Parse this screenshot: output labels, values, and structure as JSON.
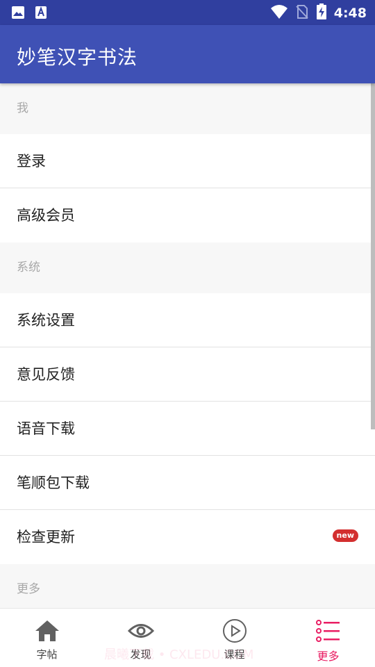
{
  "status_bar": {
    "time": "4:48",
    "left_icons": [
      "image-icon",
      "text-font-icon"
    ],
    "right_icons": [
      "wifi-icon",
      "no-sim-icon",
      "battery-charging-icon"
    ]
  },
  "app_bar": {
    "title": "妙笔汉字书法"
  },
  "sections": [
    {
      "header": "我",
      "items": [
        {
          "label": "登录"
        },
        {
          "label": "高级会员"
        }
      ]
    },
    {
      "header": "系统",
      "items": [
        {
          "label": "系统设置"
        },
        {
          "label": "意见反馈"
        },
        {
          "label": "语音下载"
        },
        {
          "label": "笔顺包下载"
        },
        {
          "label": "检查更新",
          "badge": "new"
        }
      ]
    },
    {
      "header": "更多",
      "items": []
    }
  ],
  "bottom_nav": {
    "items": [
      {
        "label": "字帖",
        "icon": "home-icon"
      },
      {
        "label": "发现",
        "icon": "eye-icon"
      },
      {
        "label": "课程",
        "icon": "play-circle-icon"
      },
      {
        "label": "更多",
        "icon": "list-icon",
        "active": true
      }
    ]
  },
  "watermark": "晨曦下载 • CXLEDU.COM",
  "colors": {
    "status_bar": "#303f9f",
    "app_bar": "#3f51b5",
    "active": "#e91e63",
    "badge": "#d32f2f"
  }
}
